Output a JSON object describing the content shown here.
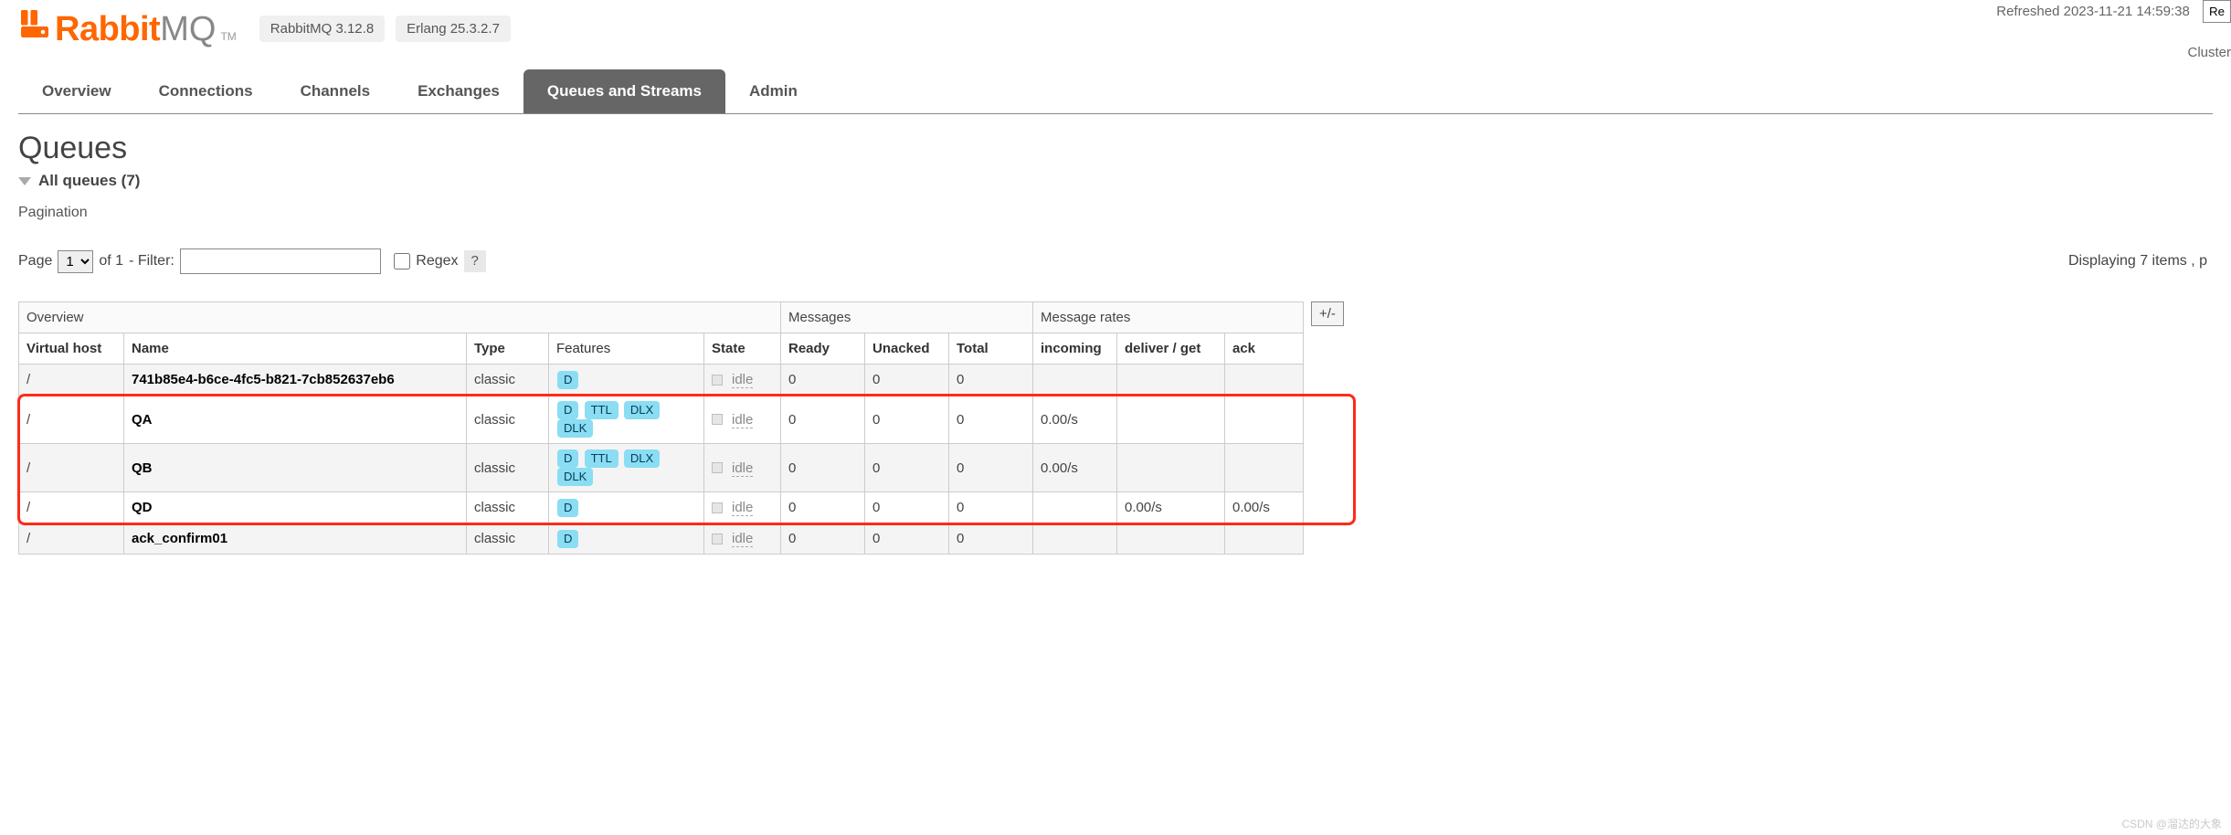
{
  "header": {
    "brand_rabbit": "Rabbit",
    "brand_mq": "MQ",
    "tm": "TM",
    "version_rabbit": "RabbitMQ 3.12.8",
    "version_erlang": "Erlang 25.3.2.7",
    "refreshed_label": "Refreshed 2023-11-21 14:59:38",
    "refresh_btn": "Re",
    "cluster_label": "Cluster"
  },
  "tabs": {
    "items": [
      {
        "label": "Overview"
      },
      {
        "label": "Connections"
      },
      {
        "label": "Channels"
      },
      {
        "label": "Exchanges"
      },
      {
        "label": "Queues and Streams"
      },
      {
        "label": "Admin"
      }
    ],
    "active_index": 4
  },
  "page": {
    "title": "Queues",
    "all_queues_label": "All queues (7)",
    "pagination_label": "Pagination",
    "page_word": "Page",
    "page_value": "1",
    "of_word": "of 1",
    "filter_label": "- Filter:",
    "regex_label": "Regex",
    "help_q": "?",
    "displaying": "Displaying 7 items , p",
    "plusminus": "+/-",
    "watermark": "CSDN @溜达的大象"
  },
  "table": {
    "groups": {
      "overview": "Overview",
      "messages": "Messages",
      "rates": "Message rates"
    },
    "cols": {
      "vhost": "Virtual host",
      "name": "Name",
      "type": "Type",
      "features": "Features",
      "state": "State",
      "ready": "Ready",
      "unacked": "Unacked",
      "total": "Total",
      "incoming": "incoming",
      "deliver_get": "deliver / get",
      "ack": "ack"
    },
    "rows": [
      {
        "vhost": "/",
        "name": "741b85e4-b6ce-4fc5-b821-7cb852637eb6",
        "type": "classic",
        "features": [
          "D"
        ],
        "state": "idle",
        "ready": "0",
        "unacked": "0",
        "total": "0",
        "incoming": "",
        "deliver_get": "",
        "ack": ""
      },
      {
        "vhost": "/",
        "name": "QA",
        "type": "classic",
        "features": [
          "D",
          "TTL",
          "DLX",
          "DLK"
        ],
        "state": "idle",
        "ready": "0",
        "unacked": "0",
        "total": "0",
        "incoming": "0.00/s",
        "deliver_get": "",
        "ack": ""
      },
      {
        "vhost": "/",
        "name": "QB",
        "type": "classic",
        "features": [
          "D",
          "TTL",
          "DLX",
          "DLK"
        ],
        "state": "idle",
        "ready": "0",
        "unacked": "0",
        "total": "0",
        "incoming": "0.00/s",
        "deliver_get": "",
        "ack": ""
      },
      {
        "vhost": "/",
        "name": "QD",
        "type": "classic",
        "features": [
          "D"
        ],
        "state": "idle",
        "ready": "0",
        "unacked": "0",
        "total": "0",
        "incoming": "",
        "deliver_get": "0.00/s",
        "ack": "0.00/s"
      },
      {
        "vhost": "/",
        "name": "ack_confirm01",
        "type": "classic",
        "features": [
          "D"
        ],
        "state": "idle",
        "ready": "0",
        "unacked": "0",
        "total": "0",
        "incoming": "",
        "deliver_get": "",
        "ack": ""
      }
    ],
    "highlight_rows": [
      1,
      2,
      3
    ]
  },
  "chart_data": {
    "type": "table",
    "title": "Queues",
    "columns": [
      "Virtual host",
      "Name",
      "Type",
      "Features",
      "State",
      "Ready",
      "Unacked",
      "Total",
      "incoming",
      "deliver / get",
      "ack"
    ],
    "rows": [
      [
        "/",
        "741b85e4-b6ce-4fc5-b821-7cb852637eb6",
        "classic",
        "D",
        "idle",
        0,
        0,
        0,
        null,
        null,
        null
      ],
      [
        "/",
        "QA",
        "classic",
        "D TTL DLX DLK",
        "idle",
        0,
        0,
        0,
        0.0,
        null,
        null
      ],
      [
        "/",
        "QB",
        "classic",
        "D TTL DLX DLK",
        "idle",
        0,
        0,
        0,
        0.0,
        null,
        null
      ],
      [
        "/",
        "QD",
        "classic",
        "D",
        "idle",
        0,
        0,
        0,
        null,
        0.0,
        0.0
      ],
      [
        "/",
        "ack_confirm01",
        "classic",
        "D",
        "idle",
        0,
        0,
        0,
        null,
        null,
        null
      ]
    ]
  }
}
